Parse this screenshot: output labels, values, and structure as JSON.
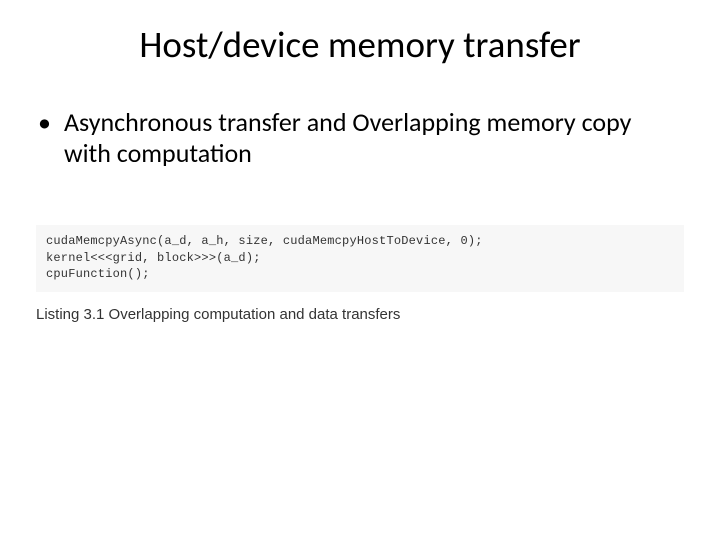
{
  "title": "Host/device memory transfer",
  "bullets": [
    "Asynchronous transfer and  Overlapping memory copy with computation"
  ],
  "code": {
    "line1": "cudaMemcpyAsync(a_d, a_h, size, cudaMemcpyHostToDevice, 0);",
    "line2": "kernel<<<grid, block>>>(a_d);",
    "line3": "cpuFunction();"
  },
  "caption": "Listing 3.1 Overlapping computation and data transfers"
}
